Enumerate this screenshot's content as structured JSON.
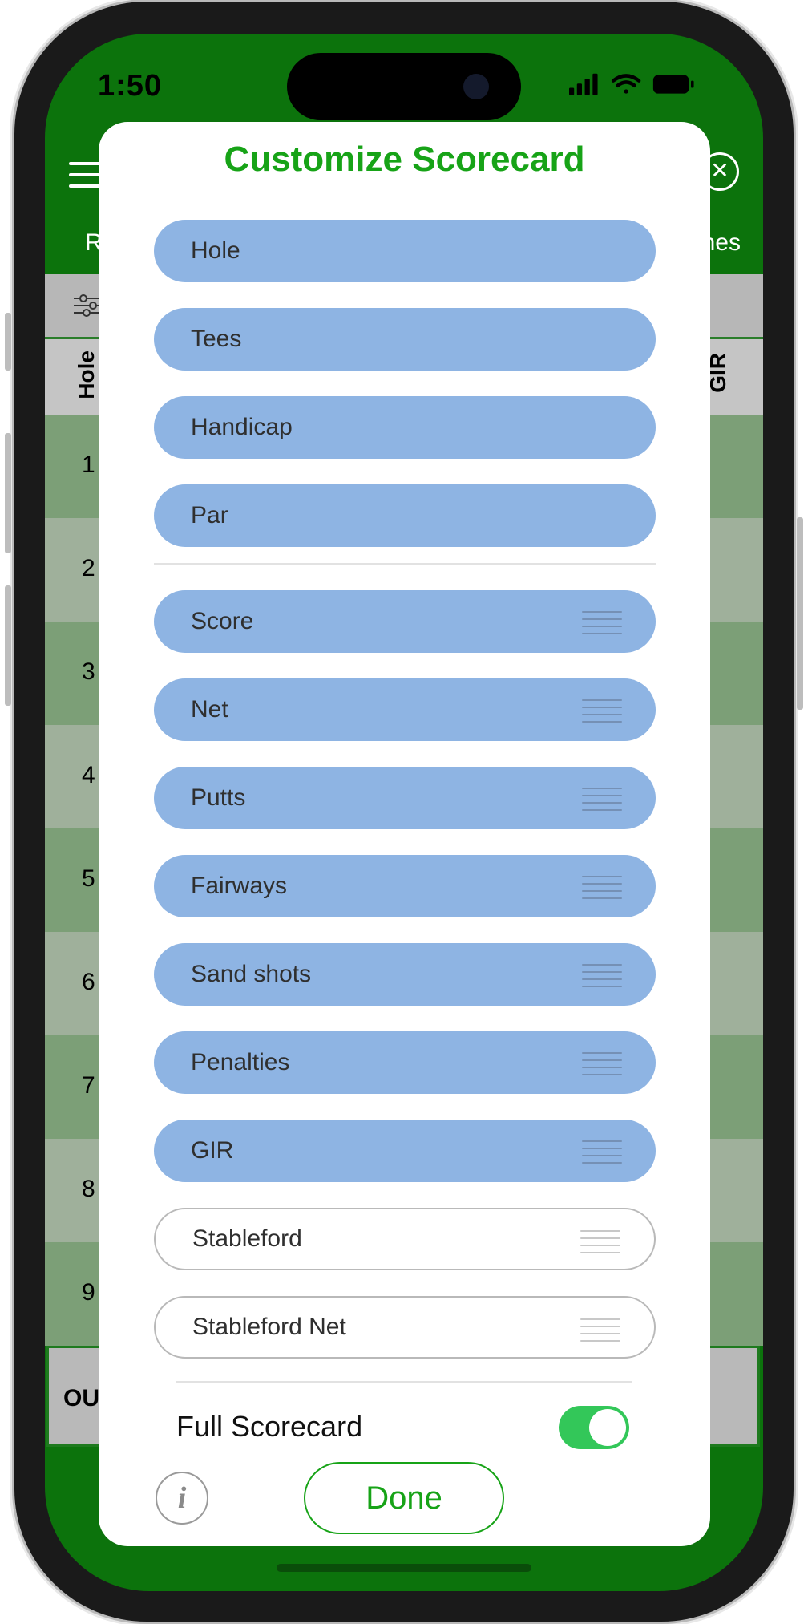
{
  "status_bar": {
    "time": "1:50",
    "icons": [
      "signal-icon",
      "wifi-icon",
      "battery-icon"
    ]
  },
  "background": {
    "tab_left": "R",
    "tab_right": "nes",
    "column_headers": [
      "Hole",
      "GIR"
    ],
    "rows": [
      "1",
      "2",
      "3",
      "4",
      "5",
      "6",
      "7",
      "8",
      "9"
    ],
    "out_label": "OU"
  },
  "modal": {
    "title": "Customize Scorecard",
    "fixed_items": [
      {
        "label": "Hole"
      },
      {
        "label": "Tees"
      },
      {
        "label": "Handicap"
      },
      {
        "label": "Par"
      }
    ],
    "sortable_items": [
      {
        "label": "Score",
        "enabled": true
      },
      {
        "label": "Net",
        "enabled": true
      },
      {
        "label": "Putts",
        "enabled": true
      },
      {
        "label": "Fairways",
        "enabled": true
      },
      {
        "label": "Sand shots",
        "enabled": true
      },
      {
        "label": "Penalties",
        "enabled": true
      },
      {
        "label": "GIR",
        "enabled": true
      },
      {
        "label": "Stableford",
        "enabled": false
      },
      {
        "label": "Stableford Net",
        "enabled": false
      }
    ],
    "full_scorecard": {
      "label": "Full Scorecard",
      "enabled": true
    },
    "info_icon": "i",
    "done_label": "Done"
  },
  "colors": {
    "app_green": "#0c730c",
    "accent_green": "#17a317",
    "pill_blue": "#8eb4e3",
    "toggle_on": "#33c759"
  }
}
